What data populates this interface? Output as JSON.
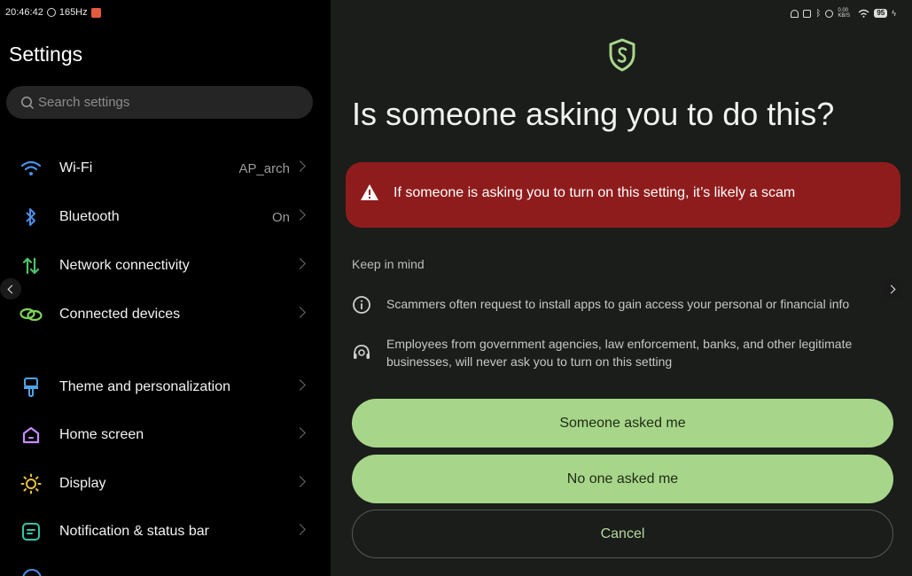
{
  "left_status": {
    "time": "20:46:42",
    "refresh": "165Hz"
  },
  "settings": {
    "title": "Settings",
    "search_placeholder": "Search settings",
    "items": [
      {
        "label": "Wi-Fi",
        "value": "AP_arch",
        "icon": "wifi-icon",
        "icon_color": "#4c8fe8"
      },
      {
        "label": "Bluetooth",
        "value": "On",
        "icon": "bluetooth-icon",
        "icon_color": "#4c8fe8"
      },
      {
        "label": "Network connectivity",
        "value": "",
        "icon": "network-arrows-icon",
        "icon_color": "#4ec26a"
      },
      {
        "label": "Connected devices",
        "value": "",
        "icon": "link-icon",
        "icon_color": "#7fd35a"
      },
      {
        "label": "Theme and personalization",
        "value": "",
        "icon": "brush-icon",
        "icon_color": "#4fa4e6"
      },
      {
        "label": "Home screen",
        "value": "",
        "icon": "home-icon",
        "icon_color": "#c68cff"
      },
      {
        "label": "Display",
        "value": "",
        "icon": "sun-icon",
        "icon_color": "#e9c239"
      },
      {
        "label": "Notification & status bar",
        "value": "",
        "icon": "notification-icon",
        "icon_color": "#35c3a8"
      }
    ]
  },
  "right_status": {
    "net_speed": "0.00 KB/S",
    "battery": "95"
  },
  "dialog": {
    "title": "Is someone asking you to do this?",
    "warning": "If someone is asking you to turn on this setting, it’s likely a scam",
    "keep_in_mind": "Keep in mind",
    "tips": [
      {
        "icon": "info-icon",
        "lines": [
          "Scammers often request to install apps to gain access your personal or financial info"
        ]
      },
      {
        "icon": "agent-headset-icon",
        "lines": [
          "Employees from government agencies, law enforcement, banks, and other legitimate",
          "businesses, will never ask you to turn on this setting"
        ]
      }
    ],
    "buttons": {
      "someone_asked": "Someone asked me",
      "no_one_asked": "No one asked me",
      "cancel": "Cancel"
    }
  },
  "colors": {
    "accent_green": "#a7d68a",
    "warning_red": "#8f1c1c",
    "shield_green": "#a8d68a"
  }
}
